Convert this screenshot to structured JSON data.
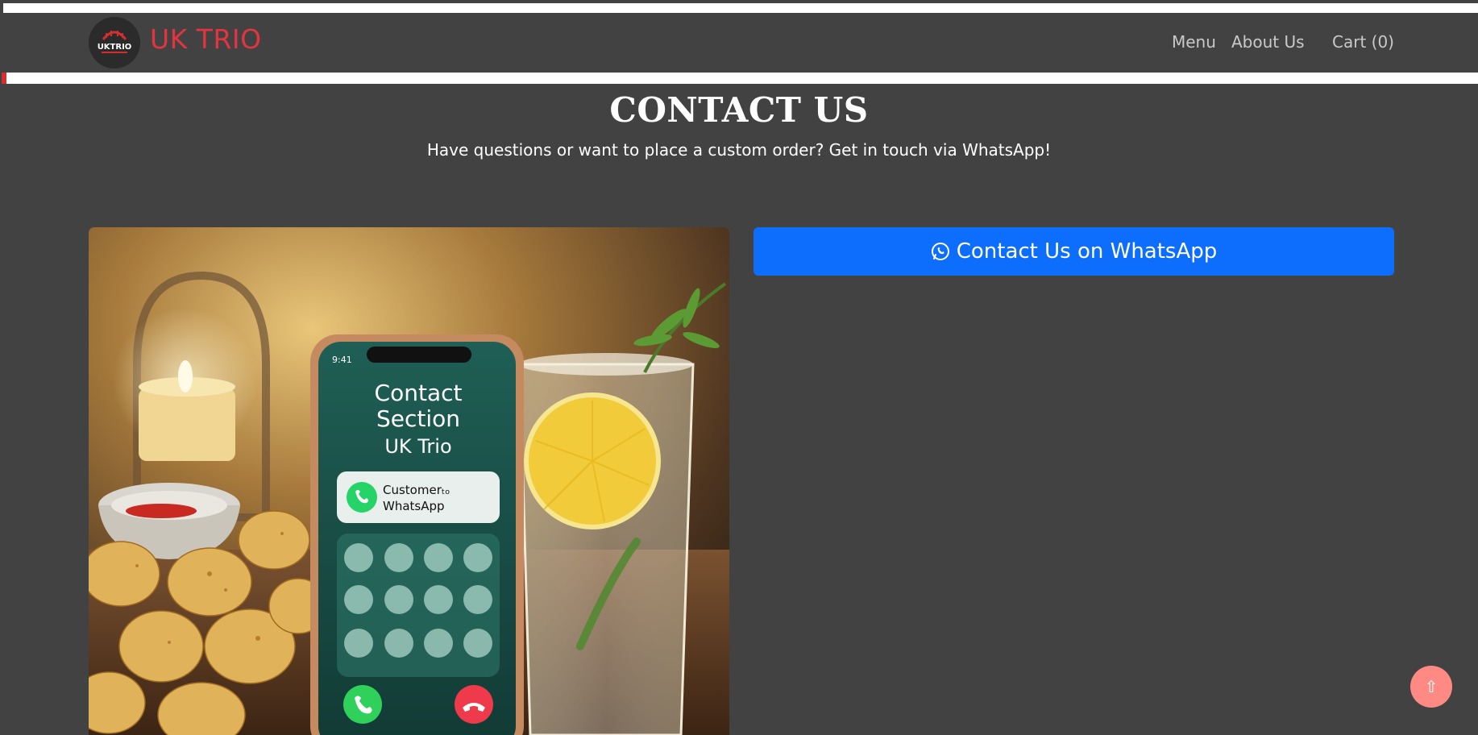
{
  "brand": {
    "name": "UK TRIO",
    "logo_text": "UKTRIO"
  },
  "nav": {
    "links": [
      {
        "label": "Menu"
      },
      {
        "label": "About Us"
      },
      {
        "label": "Cart (0)"
      }
    ]
  },
  "page": {
    "title": "CONTACT US",
    "subtitle": "Have questions or want to place a custom order? Get in touch via WhatsApp!"
  },
  "hero_image": {
    "screen_title": "Contact Section UK Trio",
    "screen_title_lines": [
      "Contact",
      "Section",
      "UK Trio"
    ],
    "card_text_lines": [
      "Customerₜₒ",
      "WhatsApp"
    ],
    "status_text": "9:41"
  },
  "contact": {
    "whatsapp_label": "Contact Us on WhatsApp",
    "icon": "whatsapp-icon"
  },
  "scroll_top": {
    "label": "⇧"
  },
  "colors": {
    "background": "#424242",
    "brand": "#e2353f",
    "button": "#0d6efd",
    "scroll_top": "#ff8a84"
  }
}
